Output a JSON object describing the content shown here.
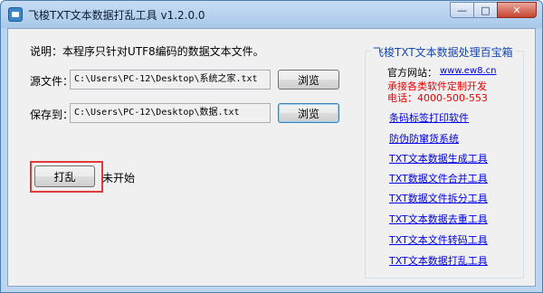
{
  "window": {
    "title": "飞梭TXT文本数据打乱工具 v1.2.0.0",
    "minimize_glyph": "—",
    "maximize_glyph": "□",
    "close_glyph": "✕"
  },
  "main": {
    "description": "说明：本程序只针对UTF8编码的数据文本文件。",
    "source_label": "源文件：",
    "source_value": "C:\\Users\\PC-12\\Desktop\\系统之家.txt",
    "save_label": "保存到：",
    "save_value": "C:\\Users\\PC-12\\Desktop\\数据.txt",
    "browse_label": "浏览",
    "shuffle_label": "打乱",
    "status": "未开始"
  },
  "toolbox": {
    "title": "飞梭TXT文本数据处理百宝箱",
    "website_label": "官方网站：",
    "website_url": "www.ew8.cn",
    "custom_dev": "承接各类软件定制开发",
    "phone": "电话：4000-500-553",
    "links": [
      "条码标签打印软件",
      "防伪防窜货系统",
      "TXT文本数据生成工具",
      "TXT数据文件合并工具",
      "TXT数据文件拆分工具",
      "TXT文本数据去重工具",
      "TXT文本文件转码工具",
      "TXT文本数据打乱工具"
    ]
  },
  "colors": {
    "highlight": "#e23a3a",
    "link": "#0000ee",
    "accent_red": "#ee0000",
    "group_title": "#1547b8"
  },
  "icons": {
    "app": "app-icon"
  }
}
